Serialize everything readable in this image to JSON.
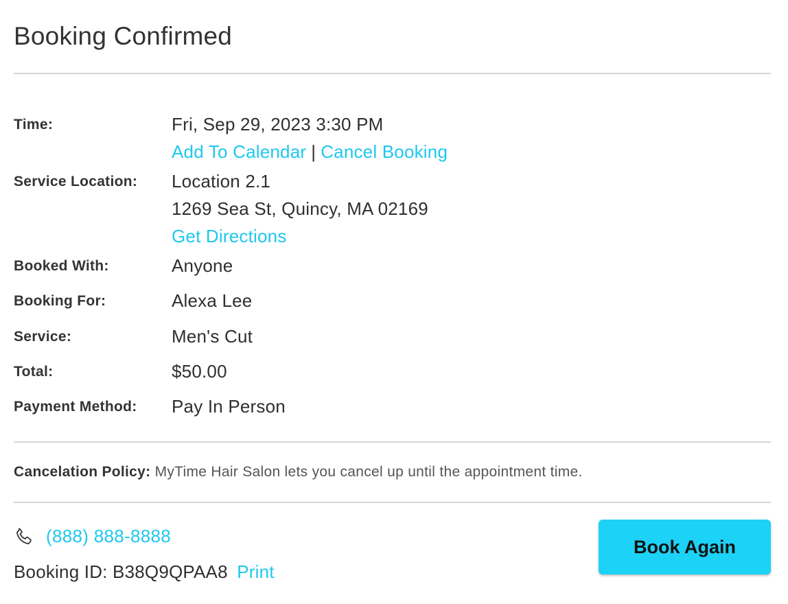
{
  "header": {
    "title": "Booking Confirmed"
  },
  "details": {
    "time": {
      "label": "Time:",
      "value": "Fri, Sep 29, 2023 3:30 PM",
      "add_calendar": "Add To Calendar",
      "separator": "|",
      "cancel_booking": "Cancel Booking"
    },
    "location": {
      "label": "Service Location:",
      "name": "Location 2.1",
      "address": "1269 Sea St, Quincy, MA 02169",
      "directions": "Get Directions"
    },
    "booked_with": {
      "label": "Booked With:",
      "value": "Anyone"
    },
    "booking_for": {
      "label": "Booking For:",
      "value": "Alexa Lee"
    },
    "service": {
      "label": "Service:",
      "value": "Men's Cut"
    },
    "total": {
      "label": "Total:",
      "value": "$50.00"
    },
    "payment": {
      "label": "Payment Method:",
      "value": "Pay In Person"
    }
  },
  "policy": {
    "label": "Cancelation Policy:",
    "text": "MyTime Hair Salon lets you cancel up until the appointment time."
  },
  "footer": {
    "phone_icon": "phone-icon",
    "phone": "(888) 888-8888",
    "booking_id_label": "Booking ID: B38Q9QPAA8",
    "print": "Print",
    "book_again": "Book Again"
  },
  "colors": {
    "link": "#1ec8ee",
    "button": "#1cd2f7",
    "divider": "#d6d6d6",
    "text": "#2f2f2f"
  }
}
